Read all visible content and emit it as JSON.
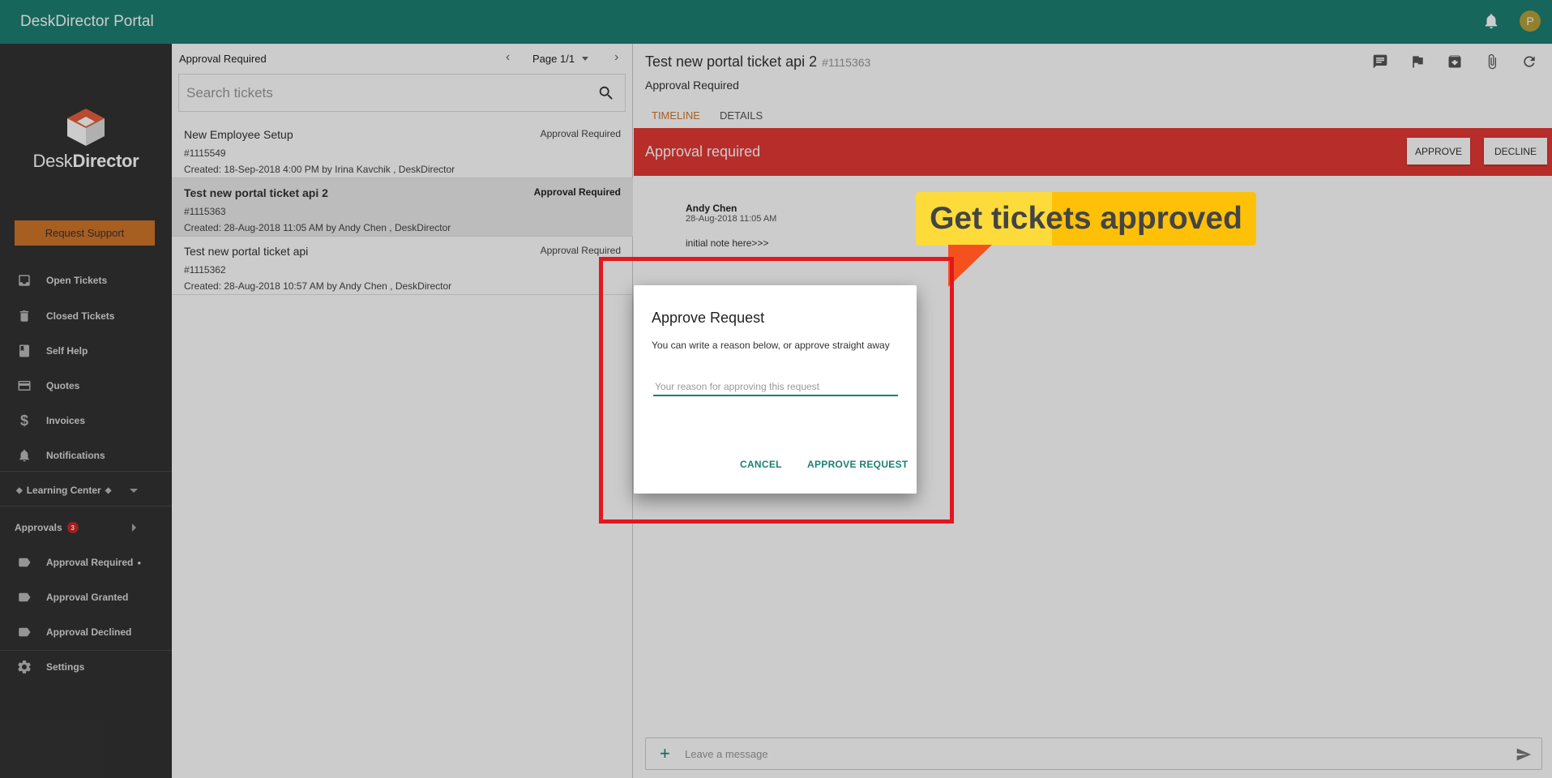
{
  "app": {
    "title": "DeskDirector Portal",
    "avatar_letter": "P"
  },
  "logo": {
    "text_light": "Desk",
    "text_bold": "Director"
  },
  "sidebar": {
    "request_support": "Request Support",
    "items": [
      {
        "label": "Open Tickets",
        "icon": "inbox-icon"
      },
      {
        "label": "Closed Tickets",
        "icon": "trash-icon"
      },
      {
        "label": "Self Help",
        "icon": "book-icon"
      },
      {
        "label": "Quotes",
        "icon": "card-icon"
      },
      {
        "label": "Invoices",
        "icon": "dollar-icon"
      },
      {
        "label": "Notifications",
        "icon": "bell-icon"
      }
    ],
    "learning_center": "Learning Center",
    "approvals": {
      "label": "Approvals",
      "count": "3"
    },
    "approval_items": [
      {
        "label": "Approval Required",
        "icon": "label-icon"
      },
      {
        "label": "Approval Granted",
        "icon": "label-icon"
      },
      {
        "label": "Approval Declined",
        "icon": "label-icon"
      }
    ],
    "settings": "Settings"
  },
  "list": {
    "title": "Approval Required",
    "page": "Page 1/1",
    "search_placeholder": "Search tickets",
    "tickets": [
      {
        "title": "New Employee Setup",
        "status": "Approval Required",
        "number": "#1115549",
        "created": "Created: 18-Sep-2018 4:00 PM by Irina Kavchik , DeskDirector"
      },
      {
        "title": "Test new portal ticket api 2",
        "status": "Approval Required",
        "number": "#1115363",
        "created": "Created: 28-Aug-2018 11:05 AM by Andy Chen , DeskDirector"
      },
      {
        "title": "Test new portal ticket api",
        "status": "Approval Required",
        "number": "#1115362",
        "created": "Created: 28-Aug-2018 10:57 AM by Andy Chen , DeskDirector"
      }
    ]
  },
  "detail": {
    "title": "Test new portal ticket api 2",
    "number": "#1115363",
    "status": "Approval Required",
    "tabs": [
      "TIMELINE",
      "DETAILS"
    ],
    "banner": {
      "text": "Approval required",
      "approve": "APPROVE",
      "decline": "DECLINE"
    },
    "note": {
      "author": "Andy Chen",
      "date": "28-Aug-2018 11:05 AM",
      "text": "initial note here>>>"
    },
    "composer_placeholder": "Leave a message"
  },
  "dialog": {
    "title": "Approve Request",
    "text": "You can write a reason below, or approve straight away",
    "input_placeholder": "Your reason for approving this request",
    "cancel": "CANCEL",
    "approve": "APPROVE REQUEST"
  },
  "callout": {
    "text": "Get tickets approved"
  },
  "colors": {
    "topbar": "#1c8073",
    "sidebar": "#333333",
    "accent": "#d1762a",
    "banner": "#e53935",
    "highlight": "#e3171d"
  }
}
